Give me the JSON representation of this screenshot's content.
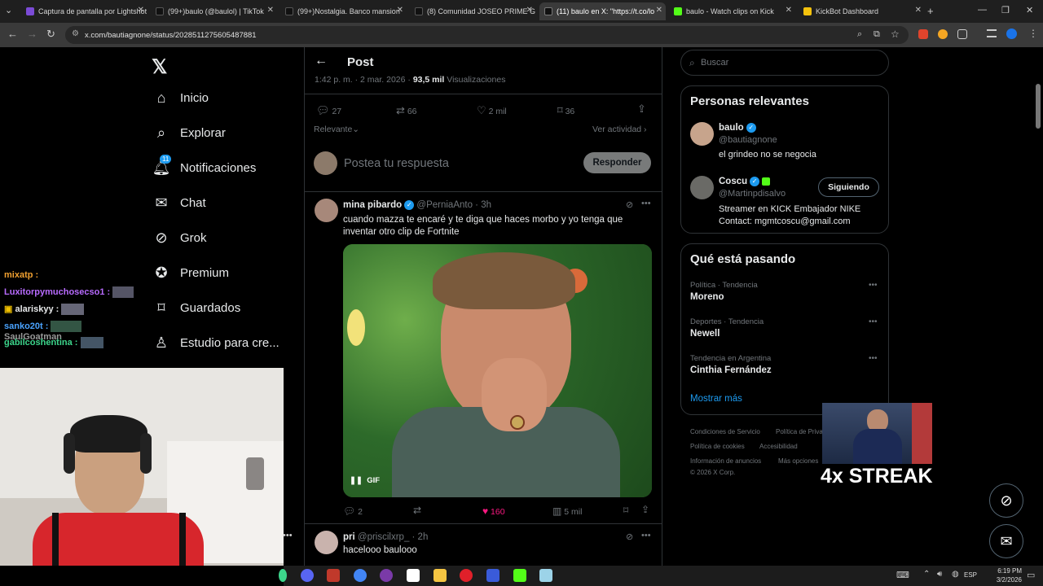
{
  "browser": {
    "tabs": [
      {
        "label": "Captura de pantalla por Lightshot",
        "color": "#7b4bd6"
      },
      {
        "label": "(99+)baulo (@baulol) | TikTok",
        "color": "#111111"
      },
      {
        "label": "(99+)Nostalgia. Banco mansion",
        "color": "#111111"
      },
      {
        "label": "(8) Comunidad JOSEO PRIME G",
        "color": "#111111"
      },
      {
        "label": "(11) baulo en X: \"https://t.co/lo",
        "color": "#111111"
      },
      {
        "label": "baulo - Watch clips on Kick",
        "color": "#53fc18"
      },
      {
        "label": "KickBot Dashboard",
        "color": "#f4c20d"
      }
    ],
    "url": "x.com/bautiagnone/status/2028511275605487881"
  },
  "sidebar": {
    "items": [
      {
        "label": "Inicio",
        "icon": "home-icon"
      },
      {
        "label": "Explorar",
        "icon": "search-icon"
      },
      {
        "label": "Notificaciones",
        "icon": "bell-icon",
        "badge": "11"
      },
      {
        "label": "Chat",
        "icon": "mail-icon"
      },
      {
        "label": "Grok",
        "icon": "grok-icon"
      },
      {
        "label": "Premium",
        "icon": "premium-icon"
      },
      {
        "label": "Guardados",
        "icon": "bookmark-icon"
      },
      {
        "label": "Estudio para cre..."
      }
    ]
  },
  "chat_overlay": [
    {
      "user": "mixatp",
      "color": "#f0a030"
    },
    {
      "user": "Luxitorpymuchosecso1",
      "color": "#b86bff"
    },
    {
      "user": "alariskyy",
      "color": "#e7e9ea"
    },
    {
      "user": "sanko20t",
      "color": "#4aa3ff"
    },
    {
      "user": "SaulGoatman",
      "color": "#9a9a9a"
    },
    {
      "user": "gabilcoshentina",
      "color": "#3dd68c"
    }
  ],
  "post": {
    "header_title": "Post",
    "meta_time": "1:42 p. m. · 2 mar. 2026 · ",
    "meta_views": "93,5 mil",
    "meta_views_label": " Visualizaciones",
    "stats": {
      "replies": "27",
      "reposts": "66",
      "likes": "2 mil",
      "bookmarks": "36"
    },
    "sort_label": "Relevante",
    "activity_label": "Ver actividad",
    "reply_placeholder": "Postea tu respuesta",
    "reply_button": "Responder"
  },
  "reply1": {
    "name": "mina pibardo",
    "handle": "@PerniaAnto · 3h",
    "text": "cuando mazza te encaré y te diga que haces morbo y yo tenga que inventar otro clip de Fortnite",
    "gif_label": "GIF",
    "stats": {
      "replies": "2",
      "likes": "160",
      "views": "5 mil"
    }
  },
  "reply2": {
    "name": "pri",
    "handle": "@priscilxrp_ · 2h",
    "text": "hacelooo baulooo"
  },
  "right": {
    "search_placeholder": "Buscar",
    "relevant_title": "Personas relevantes",
    "people": [
      {
        "name": "baulo",
        "handle": "@bautiagnone",
        "bio": "el grindeo no se negocia"
      },
      {
        "name": "Coscu",
        "handle": "@Martinpdisalvo",
        "bio": "Streamer en KICK Embajador NIKE Contact: mgmtcoscu@gmail.com",
        "button": "Siguiendo"
      }
    ],
    "trending_title": "Qué está pasando",
    "trends": [
      {
        "context": "Política · Tendencia",
        "topic": "Moreno"
      },
      {
        "context": "Deportes · Tendencia",
        "topic": "Newell"
      },
      {
        "context": "Tendencia en Argentina",
        "topic": "Cinthia Fernández"
      }
    ],
    "show_more": "Mostrar más",
    "footer": [
      "Condiciones de Servicio",
      "Política de Priva",
      "Política de cookies",
      "Accesibilidad",
      "Información de anuncios",
      "Más opciones",
      "© 2026 X Corp."
    ]
  },
  "overlay": {
    "streak": "4x STREAK"
  },
  "taskbar": {
    "lang": "ESP",
    "time": "6:19 PM",
    "date": "3/2/2026"
  }
}
